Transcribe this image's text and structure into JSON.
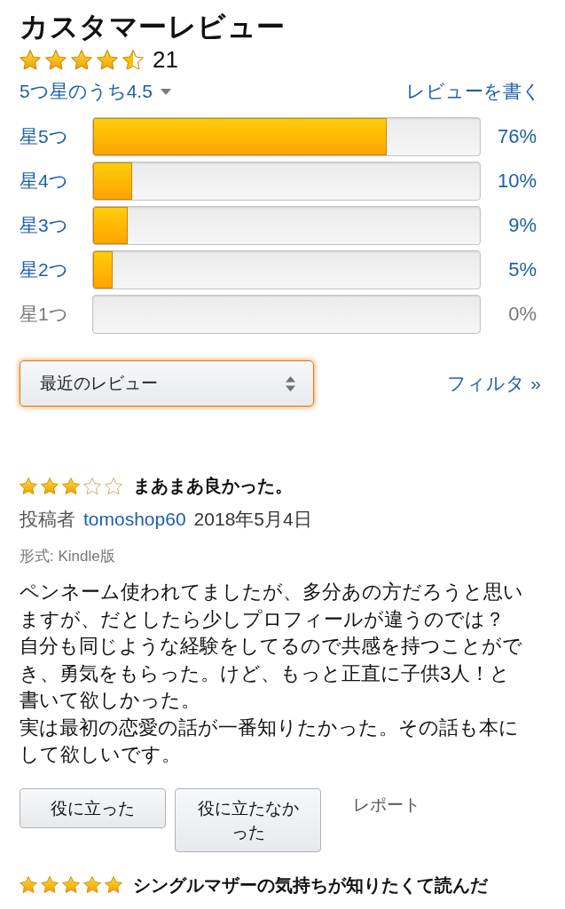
{
  "header": {
    "title": "カスタマーレビュー"
  },
  "overall": {
    "stars": 4.5,
    "count": "21",
    "summary": "5つ星のうち4.5",
    "write_review": "レビューを書く"
  },
  "histogram": [
    {
      "label": "星5つ",
      "level": 0.76,
      "percent": "76%",
      "disabled": false
    },
    {
      "label": "星4つ",
      "level": 0.1,
      "percent": "10%",
      "disabled": false
    },
    {
      "label": "星3つ",
      "level": 0.09,
      "percent": "9%",
      "disabled": false
    },
    {
      "label": "星2つ",
      "level": 0.05,
      "percent": "5%",
      "disabled": false
    },
    {
      "label": "星1つ",
      "percent": "0%",
      "disabled": true
    }
  ],
  "sort": {
    "value": "最近のレビュー",
    "focused": true
  },
  "filter": {
    "label": "フィルタ »"
  },
  "reviews": [
    {
      "stars": 3,
      "title": "まあまあ良かった。",
      "by_label": "投稿者",
      "author": "tomoshop60",
      "date": "2018年5月4日",
      "format": "形式: Kindle版",
      "body": [
        "ペンネーム使われてましたが、多分あの方だろうと思いますが、だとしたら少しプロフィールが違うのでは？",
        "自分も同じような経験をしてるので共感を持つことができ、勇気をもらった。けど、もっと正直に子供3人！と書いて欲しかった。",
        "実は最初の恋愛の話が一番知りたかった。その話も本にして欲しいです。"
      ],
      "buttons": [
        "役に立った",
        "役に立たなかった"
      ],
      "report": "レポート"
    },
    {
      "stars": 5,
      "title": "シングルマザーの気持ちが知りたくて読んだ"
    }
  ]
}
